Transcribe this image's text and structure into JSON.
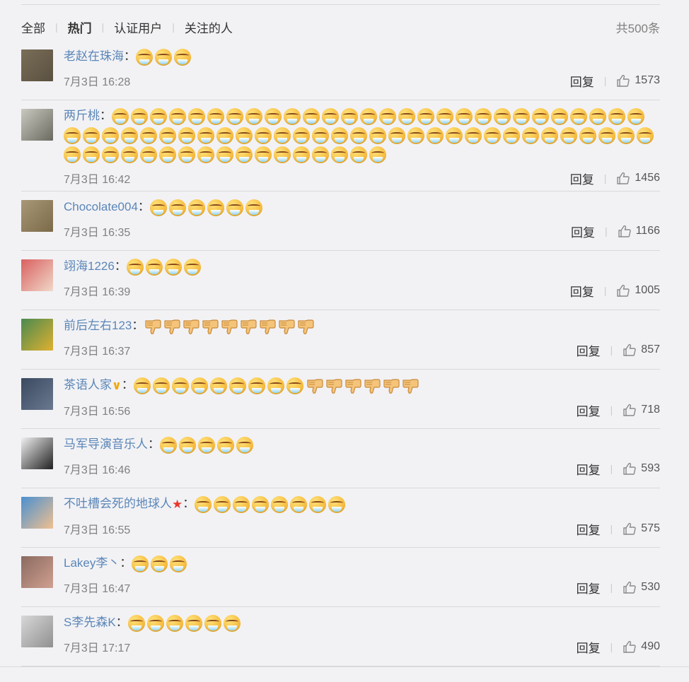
{
  "filters": {
    "all": "全部",
    "hot": "热门",
    "verified": "认证用户",
    "following": "关注的人",
    "total": "共500条"
  },
  "reply_label": "回复",
  "comments": [
    {
      "user": "老赵在珠海",
      "badge": "",
      "emojis": "ddd",
      "time": "7月3日 16:28",
      "likes": "1573",
      "avatar_colors": [
        "#7a6e58",
        "#5a5040"
      ]
    },
    {
      "user": "两斤桃",
      "badge": "",
      "emojis": "dddddddddddddddddddddddddddddddddddddddddddddddddddddddddddddddddddddddddddd",
      "time": "7月3日 16:42",
      "likes": "1456",
      "avatar_colors": [
        "#c9c9c0",
        "#6a6a60"
      ]
    },
    {
      "user": "Chocolate004",
      "badge": "",
      "emojis": "dddddd",
      "time": "7月3日 16:35",
      "likes": "1166",
      "avatar_colors": [
        "#a89878",
        "#7a6a48"
      ]
    },
    {
      "user": "翊海1226",
      "badge": "",
      "emojis": "dddd",
      "time": "7月3日 16:39",
      "likes": "1005",
      "avatar_colors": [
        "#d96060",
        "#f0d8c8"
      ]
    },
    {
      "user": "前后左右123",
      "badge": "",
      "emojis": "ttttttttt",
      "time": "7月3日 16:37",
      "likes": "857",
      "avatar_colors": [
        "#4a8a50",
        "#e0b030"
      ]
    },
    {
      "user": "茶语人家",
      "badge": "v",
      "emojis": "dddddddddtttttt",
      "time": "7月3日 16:56",
      "likes": "718",
      "avatar_colors": [
        "#3a4a60",
        "#6a7890"
      ]
    },
    {
      "user": "马军导演音乐人",
      "badge": "",
      "emojis": "ddddd",
      "time": "7月3日 16:46",
      "likes": "593",
      "avatar_colors": [
        "#f0f0f0",
        "#202020"
      ]
    },
    {
      "user": "不吐槽会死的地球人",
      "badge": "star",
      "emojis": "dddddddd",
      "time": "7月3日 16:55",
      "likes": "575",
      "avatar_colors": [
        "#4a90d0",
        "#f0c090"
      ]
    },
    {
      "user": "Lakey李丶",
      "badge": "",
      "emojis": "ddd",
      "time": "7月3日 16:47",
      "likes": "530",
      "avatar_colors": [
        "#8a6a60",
        "#d0a090"
      ]
    },
    {
      "user": "S李先森K",
      "badge": "",
      "emojis": "dddddd",
      "time": "7月3日 17:17",
      "likes": "490",
      "avatar_colors": [
        "#d8d8d8",
        "#909090"
      ]
    }
  ],
  "icons": {
    "emoji_main": "drooling-emoji-icon",
    "emoji_thumb": "thumbs-down-emoji-icon",
    "like": "thumbs-up-icon"
  },
  "colors": {
    "username": "#5b86b7",
    "background": "#f2f2f5",
    "divider": "#d9d9d9"
  }
}
